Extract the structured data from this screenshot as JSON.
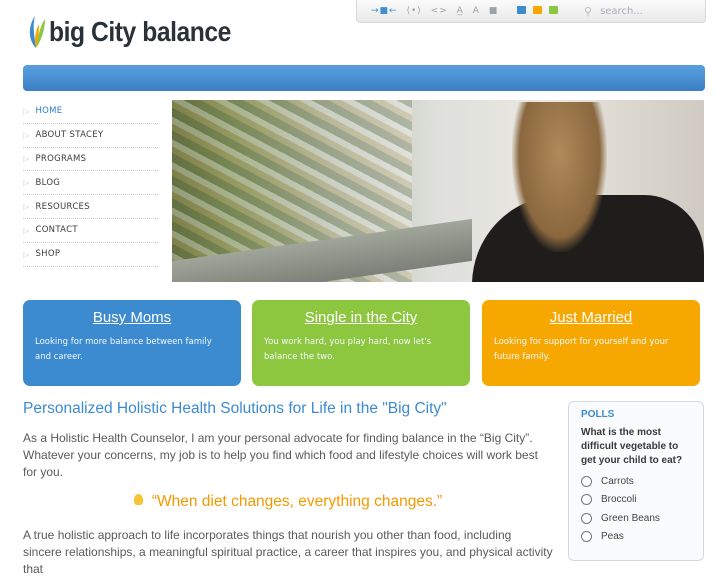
{
  "brand": {
    "name": "big City balance"
  },
  "toolbar": {
    "icons": [
      "share-icon",
      "code-width-icon",
      "code-icon",
      "font-size-icon",
      "text-icon",
      "square-icon"
    ],
    "swatches": [
      "#3c8bd0",
      "#f6a800",
      "#8dc63f"
    ],
    "search_placeholder": "search..."
  },
  "nav": [
    {
      "label": "HOME",
      "active": true
    },
    {
      "label": "ABOUT STACEY"
    },
    {
      "label": "PROGRAMS"
    },
    {
      "label": "BLOG"
    },
    {
      "label": "RESOURCES"
    },
    {
      "label": "CONTACT"
    },
    {
      "label": "SHOP"
    }
  ],
  "cards": [
    {
      "title": "Busy Moms",
      "text": "Looking for more balance between family and career.",
      "color": "#3c8bd0"
    },
    {
      "title": "Single in the City",
      "text": "You work hard, you play hard, now let's balance the two.",
      "color": "#8dc63f"
    },
    {
      "title": "Just Married",
      "text": "Looking for support for yourself and your future family.",
      "color": "#f6a800"
    }
  ],
  "main": {
    "heading": "Personalized Holistic Health Solutions for Life in the \"Big City\"",
    "intro": "As a Holistic Health Counselor, I am your personal advocate for finding balance in the “Big City”. Whatever your concerns, my job is to help you find which food and lifestyle choices will work best for you.",
    "quote": "“When diet changes, everything changes.”",
    "body": "A true holistic approach to life incorporates things that nourish you other than food, including sincere relationships, a meaningful spiritual practice, a career that inspires you, and physical activity that"
  },
  "polls": {
    "title": "POLLS",
    "question": "What is the most difficult vegetable to get your child to eat?",
    "options": [
      "Carrots",
      "Broccoli",
      "Green Beans",
      "Peas"
    ]
  }
}
